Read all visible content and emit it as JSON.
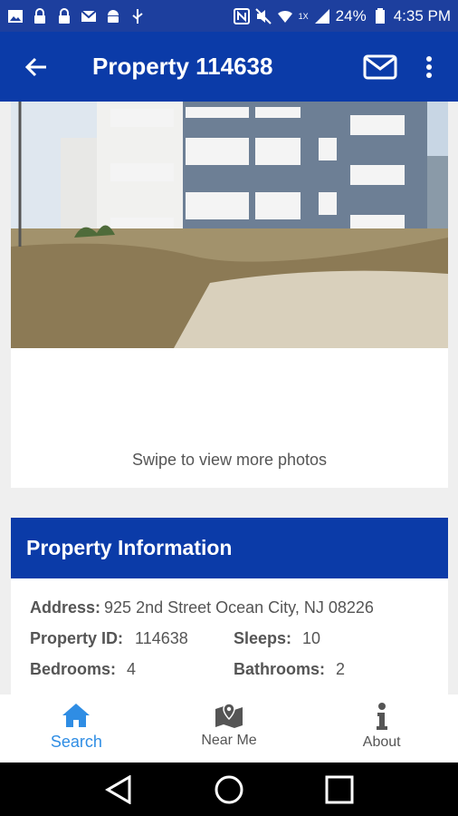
{
  "status_bar": {
    "battery": "24%",
    "time": "4:35 PM",
    "network_label": "1X",
    "icons": [
      "image-icon",
      "lock-icon",
      "lock-icon",
      "mail-icon",
      "android-icon",
      "usb-icon",
      "nfc-icon",
      "mute-icon",
      "wifi-icon",
      "signal-icon",
      "battery-icon"
    ]
  },
  "app_bar": {
    "title": "Property 114638",
    "back_icon": "arrow-left-icon",
    "mail_icon": "mail-icon",
    "more_icon": "more-vertical-icon"
  },
  "photo_card": {
    "swipe_hint": "Swipe to view more photos"
  },
  "property_info": {
    "header": "Property Information",
    "address_label": "Address:",
    "address_value": "925 2nd Street Ocean City, NJ 08226",
    "property_id_label": "Property ID:",
    "property_id_value": "114638",
    "sleeps_label": "Sleeps:",
    "sleeps_value": "10",
    "bedrooms_label": "Bedrooms:",
    "bedrooms_value": "4",
    "bathrooms_label": "Bathrooms:",
    "bathrooms_value": "2"
  },
  "bottom_nav": {
    "items": [
      {
        "label": "Search",
        "icon": "home-icon",
        "active": true
      },
      {
        "label": "Near Me",
        "icon": "map-pin-icon",
        "active": false
      },
      {
        "label": "About",
        "icon": "info-icon",
        "active": false
      }
    ]
  },
  "colors": {
    "app_bar": "#0b3ba8",
    "status_bar": "#1d3f9e",
    "active_nav": "#2f8de4"
  }
}
